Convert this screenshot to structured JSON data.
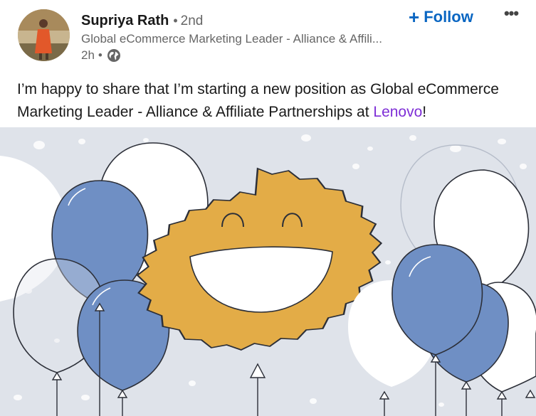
{
  "author": {
    "name": "Supriya Rath",
    "degree_separator": "•",
    "degree": "2nd",
    "headline": "Global eCommerce Marketing Leader - Alliance & Affili...",
    "time_ago": "2h",
    "meta_separator": "•",
    "visibility_icon": "globe-icon"
  },
  "actions": {
    "follow_icon": "plus-icon",
    "follow_symbol": "+",
    "follow_label": "Follow",
    "more_icon": "more-horizontal-icon",
    "more_symbol": "•••"
  },
  "post": {
    "text_before": "I’m happy to share that I’m starting a new position as Global eCommerce Marketing Leader - Alliance & Affiliate Partnerships at ",
    "company": "Lenovo",
    "text_after": "!"
  },
  "image": {
    "subject": "celebration illustration",
    "colors": {
      "background": "#dfe3ea",
      "sun": "#e3ac47",
      "balloon_blue": "#6f8fc4",
      "balloon_white": "#ffffff",
      "outline": "#2c2f38"
    }
  },
  "colors": {
    "accent": "#0a66c2",
    "mention": "#7e2ed6",
    "secondary_text": "#666666"
  }
}
